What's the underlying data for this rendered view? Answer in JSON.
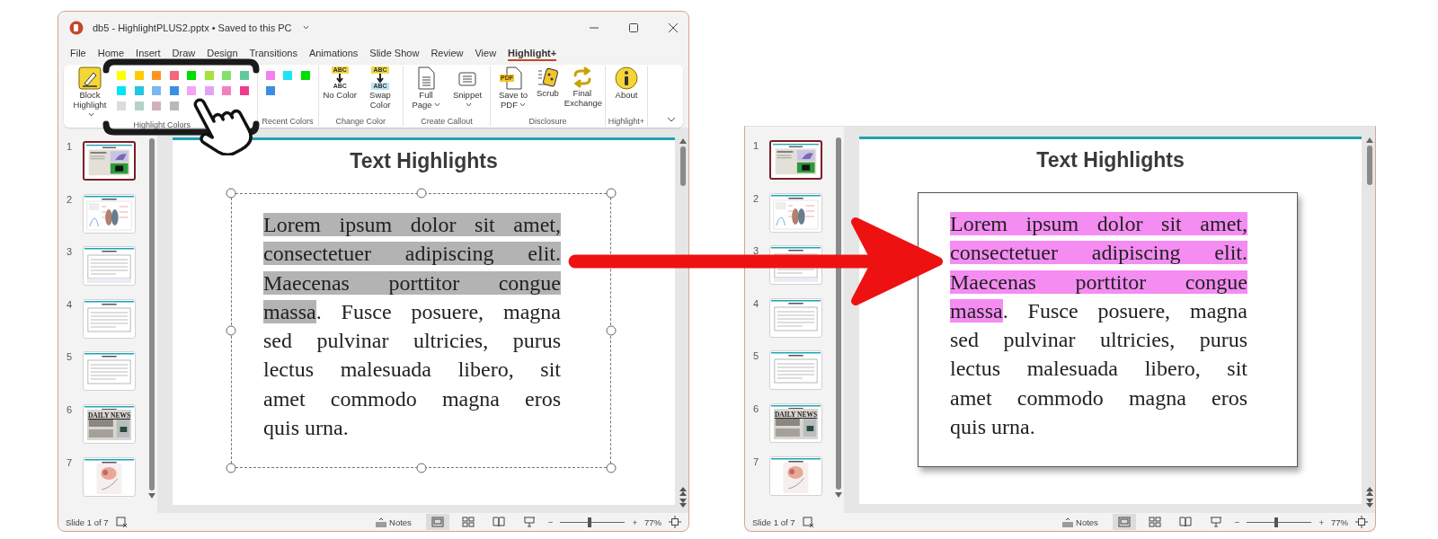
{
  "editor_window": {
    "title": "db5 - HighlightPLUS2.pptx • Saved to this PC",
    "menu_tabs": [
      {
        "label": "File",
        "selected": false
      },
      {
        "label": "Home",
        "selected": false
      },
      {
        "label": "Insert",
        "selected": false
      },
      {
        "label": "Draw",
        "selected": false
      },
      {
        "label": "Design",
        "selected": false
      },
      {
        "label": "Transitions",
        "selected": false
      },
      {
        "label": "Animations",
        "selected": false
      },
      {
        "label": "Slide Show",
        "selected": false
      },
      {
        "label": "Review",
        "selected": false
      },
      {
        "label": "View",
        "selected": false
      },
      {
        "label": "Highlight+",
        "selected": true
      }
    ],
    "ribbon": {
      "groups": [
        {
          "label": "Highlight Colors",
          "buttons": [
            {
              "kind": "marker",
              "label": "Block Highlight",
              "dropdown": true
            }
          ],
          "swatches": [
            {
              "color": "#ffff00"
            },
            {
              "color": "#ffcc00"
            },
            {
              "color": "#ff9422"
            },
            {
              "color": "#f5677a"
            },
            {
              "color": "#00dd00"
            },
            {
              "color": "#a6e23c"
            },
            {
              "color": "#84df6c"
            },
            {
              "color": "#62c99e"
            },
            {
              "color": "#00e4fa"
            },
            {
              "color": "#21c6e0"
            },
            {
              "color": "#7ab8f0"
            },
            {
              "color": "#3b8ee3"
            },
            {
              "color": "#f5a4f5"
            },
            {
              "color": "#e0a3f3"
            },
            {
              "color": "#f27fc0"
            },
            {
              "color": "#f03c8c"
            },
            {
              "color": "#d8dcdb"
            },
            {
              "color": "#b3d2c6"
            },
            {
              "color": "#d3b1b9"
            },
            {
              "color": "#b8b8b8"
            }
          ]
        },
        {
          "label": "Recent Colors",
          "swatches": [
            {
              "color": "#f47ff0"
            },
            {
              "color": "#1ee3f5"
            },
            {
              "color": "#00dd00"
            },
            {
              "color": "#3b8ee3"
            }
          ]
        },
        {
          "label": "Change Color",
          "buttons": [
            {
              "kind": "no-color",
              "label": "No Color",
              "icon_labels": [
                "ABC",
                "ABC"
              ],
              "dropdown": false
            },
            {
              "kind": "swap-color",
              "label": "Swap Color",
              "icon_labels": [
                "ABC",
                "ABC"
              ],
              "dropdown": false
            }
          ]
        },
        {
          "label": "Create Callout",
          "buttons": [
            {
              "kind": "full-page",
              "label": "Full Page",
              "dropdown": true
            },
            {
              "kind": "snippet",
              "label": "Snippet",
              "dropdown": true
            }
          ]
        },
        {
          "label": "Disclosure",
          "buttons": [
            {
              "kind": "pdf",
              "label": "Save to PDF",
              "icon_labels": [
                "PDF"
              ],
              "dropdown": true
            },
            {
              "kind": "scrub",
              "label": "Scrub",
              "dropdown": false
            },
            {
              "kind": "exchange",
              "label": "Final Exchange",
              "dropdown": false
            }
          ]
        },
        {
          "label": "Highlight+",
          "buttons": [
            {
              "kind": "about",
              "label": "About",
              "dropdown": false
            }
          ]
        }
      ]
    },
    "thumbnails": [
      {
        "number": "1",
        "kind": "photo",
        "selected": true
      },
      {
        "number": "2",
        "kind": "chart",
        "selected": false
      },
      {
        "number": "3",
        "kind": "text",
        "selected": false
      },
      {
        "number": "4",
        "kind": "text-box",
        "selected": false
      },
      {
        "number": "5",
        "kind": "text-box",
        "selected": false
      },
      {
        "number": "6",
        "kind": "newspaper",
        "heading": "DAILY NEWS",
        "selected": false
      },
      {
        "number": "7",
        "kind": "diagram",
        "selected": false
      }
    ],
    "slide": {
      "title": "Text Highlights",
      "selected": true,
      "color": "#b3b3b3",
      "lines": [
        [
          {
            "text": "Lorem ipsum dolor sit amet,",
            "highlighted": true
          }
        ],
        [
          {
            "text": "consectetuer adipiscing elit.",
            "highlighted": true
          }
        ],
        [
          {
            "text": "Maecenas porttitor congue",
            "highlighted": true
          }
        ],
        [
          {
            "text": "massa",
            "highlighted": true
          },
          {
            "text": ". Fusce posuere, magna",
            "highlighted": false
          }
        ],
        [
          {
            "text": "sed pulvinar ultricies, purus",
            "highlighted": false
          }
        ],
        [
          {
            "text": "lectus malesuada libero, sit",
            "highlighted": false
          }
        ],
        [
          {
            "text": "amet commodo magna eros",
            "highlighted": false
          }
        ],
        [
          {
            "text": "quis urna.",
            "highlighted": false
          }
        ]
      ]
    },
    "status_bar": {
      "slide_counter": "Slide 1 of 7",
      "notes_label": "Notes",
      "views": [
        {
          "kind": "normal",
          "selected": true
        },
        {
          "kind": "sorter",
          "selected": false
        },
        {
          "kind": "reading",
          "selected": false
        },
        {
          "kind": "presenter",
          "selected": false
        }
      ],
      "zoom_out": "−",
      "zoom_in": "+",
      "zoom": {
        "level": 0.45,
        "reading": "77%"
      }
    }
  },
  "result_window": {
    "thumbnails": [
      {
        "number": "1",
        "kind": "photo",
        "selected": true
      },
      {
        "number": "2",
        "kind": "chart",
        "selected": false
      },
      {
        "number": "3",
        "kind": "text",
        "selected": false
      },
      {
        "number": "4",
        "kind": "text-box",
        "selected": false
      },
      {
        "number": "5",
        "kind": "text-box",
        "selected": false
      },
      {
        "number": "6",
        "kind": "newspaper",
        "heading": "DAILY NEWS",
        "selected": false
      },
      {
        "number": "7",
        "kind": "diagram",
        "selected": false
      }
    ],
    "slide": {
      "title": "Text Highlights",
      "selected": false,
      "color": "#f48cf2",
      "lines": [
        [
          {
            "text": "Lorem ipsum dolor sit amet,",
            "highlighted": true
          }
        ],
        [
          {
            "text": "consectetuer adipiscing elit.",
            "highlighted": true
          }
        ],
        [
          {
            "text": "Maecenas porttitor congue",
            "highlighted": true
          }
        ],
        [
          {
            "text": "massa",
            "highlighted": true
          },
          {
            "text": ". Fusce posuere, magna",
            "highlighted": false
          }
        ],
        [
          {
            "text": "sed pulvinar ultricies, purus",
            "highlighted": false
          }
        ],
        [
          {
            "text": "lectus malesuada libero, sit",
            "highlighted": false
          }
        ],
        [
          {
            "text": "amet commodo magna eros",
            "highlighted": false
          }
        ],
        [
          {
            "text": "quis urna.",
            "highlighted": false
          }
        ]
      ]
    },
    "status_bar": {
      "slide_counter": "Slide 1 of 7",
      "notes_label": "Notes",
      "views": [
        {
          "kind": "normal",
          "selected": true
        },
        {
          "kind": "sorter",
          "selected": false
        },
        {
          "kind": "reading",
          "selected": false
        },
        {
          "kind": "presenter",
          "selected": false
        }
      ],
      "zoom_out": "−",
      "zoom_in": "+",
      "zoom": {
        "level": 0.45,
        "reading": "77%"
      }
    }
  }
}
